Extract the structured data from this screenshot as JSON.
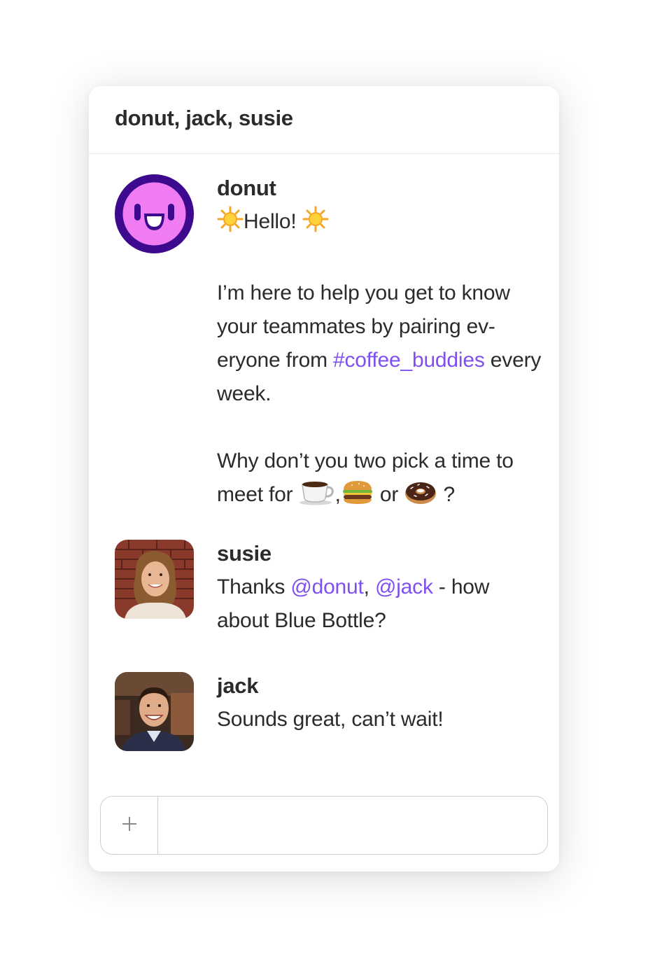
{
  "header": {
    "title": "donut, jack, susie"
  },
  "messages": [
    {
      "author": "donut",
      "avatar_icon": "donut-bot-face-icon",
      "greeting_prefix_icon": "sun-icon",
      "greeting": "Hello!",
      "greeting_suffix_icon": "sun-icon",
      "para2_text": "I’m here to help you get to know your teammates by pairing ev-eryone from",
      "para2_channel": "#coffee_buddies",
      "para2_tail": "every week.",
      "para3_text": "Why don’t you two pick a time to meet for",
      "para3_emojis": [
        "coffee-icon",
        "burger-icon",
        "donut-icon"
      ],
      "para3_sep1": ",",
      "para3_or": "or",
      "para3_end": "?"
    },
    {
      "author": "susie",
      "avatar_icon": "susie-avatar",
      "text_prefix": "Thanks",
      "mention1": "@donut",
      "comma": ",",
      "mention2": "@jack",
      "text_suffix": "- how about Blue Bottle?"
    },
    {
      "author": "jack",
      "avatar_icon": "jack-avatar",
      "text": "Sounds great, can’t wait!"
    }
  ],
  "composer": {
    "add_icon": "plus-icon",
    "value": ""
  },
  "colors": {
    "link": "#7f4ff0",
    "donut_face": "#f07cf3",
    "donut_outline": "#3d0a8f",
    "text": "#2b2b2b"
  }
}
